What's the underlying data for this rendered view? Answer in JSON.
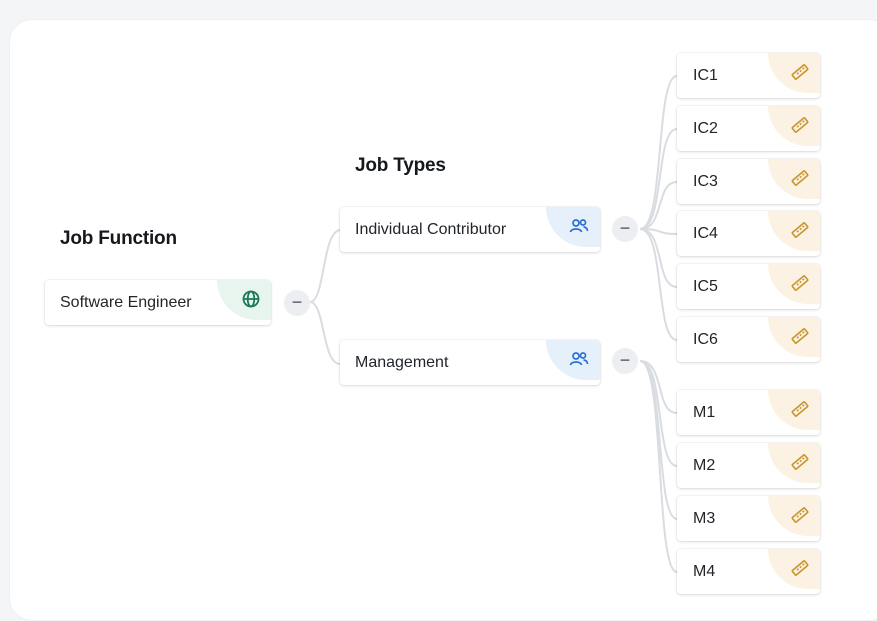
{
  "job_function": {
    "heading": "Job Function",
    "node": {
      "label": "Software Engineer",
      "icon": "globe-icon",
      "icon_color": "#1a7a54"
    },
    "toggle": "−"
  },
  "job_types": {
    "heading": "Job Types",
    "items": [
      {
        "label": "Individual Contributor",
        "icon": "users-icon",
        "icon_color": "#2b6fd6",
        "toggle": "−"
      },
      {
        "label": "Management",
        "icon": "users-icon",
        "icon_color": "#2b6fd6",
        "toggle": "−"
      }
    ]
  },
  "ic_levels": [
    {
      "label": "IC1",
      "icon": "ruler-icon"
    },
    {
      "label": "IC2",
      "icon": "ruler-icon"
    },
    {
      "label": "IC3",
      "icon": "ruler-icon"
    },
    {
      "label": "IC4",
      "icon": "ruler-icon"
    },
    {
      "label": "IC5",
      "icon": "ruler-icon"
    },
    {
      "label": "IC6",
      "icon": "ruler-icon"
    }
  ],
  "management_levels": [
    {
      "label": "M1",
      "icon": "ruler-icon"
    },
    {
      "label": "M2",
      "icon": "ruler-icon"
    },
    {
      "label": "M3",
      "icon": "ruler-icon"
    },
    {
      "label": "M4",
      "icon": "ruler-icon"
    }
  ],
  "colors": {
    "connector": "#d9dce0",
    "ruler_icon": "#c8962e",
    "level_corner": "#fcf2e3",
    "type_corner": "#e6f0fb",
    "function_corner": "#e8f5ef"
  }
}
